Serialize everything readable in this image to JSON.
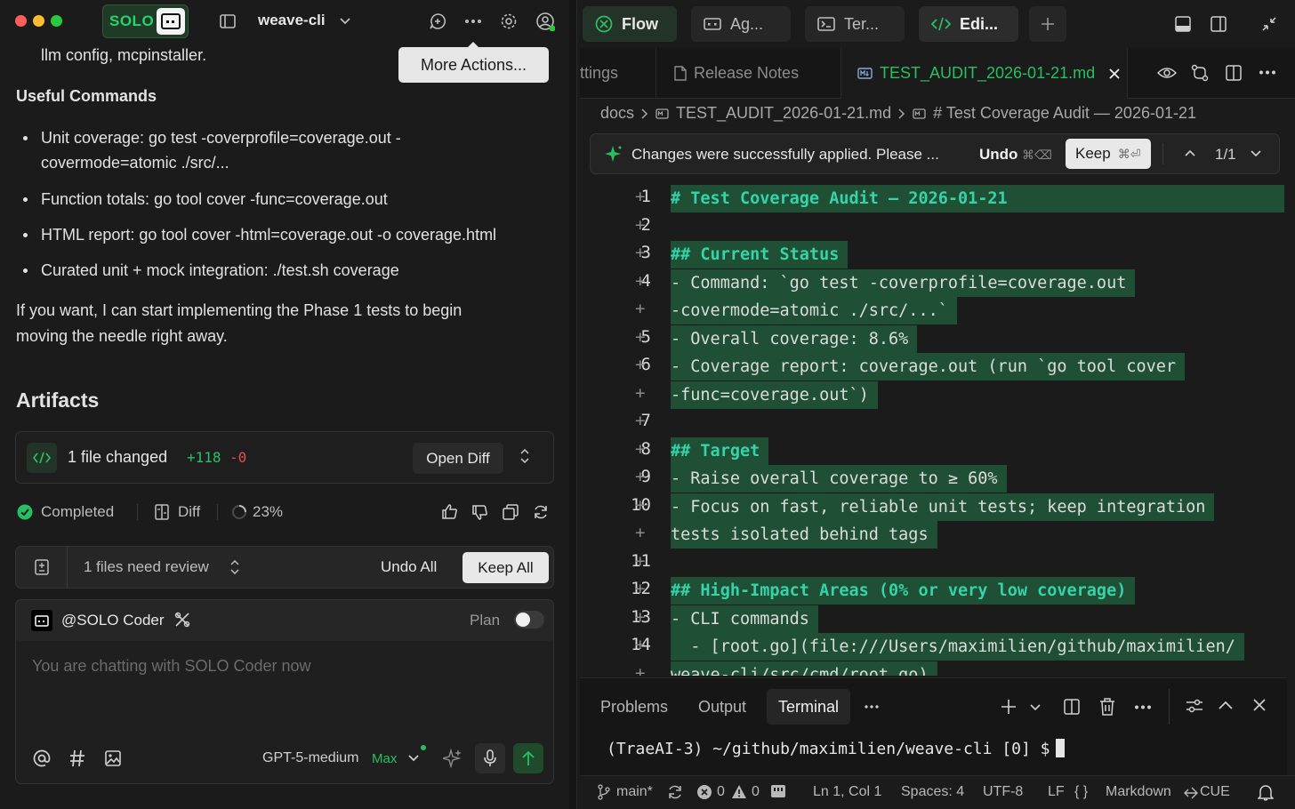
{
  "window": {
    "project": "weave-cli",
    "badge": "SOLO",
    "tooltip": "More Actions..."
  },
  "chat": {
    "line_top": "llm config, mcpinstaller.",
    "useful_heading": "Useful Commands",
    "bullets": [
      "Unit coverage: go test -coverprofile=coverage.out -",
      "covermode=atomic ./src/...",
      "Function totals: go tool cover -func=coverage.out",
      "HTML report: go tool cover -html=coverage.out -o coverage.html",
      "Curated unit + mock integration: ./test.sh coverage"
    ],
    "closing_1": "If you want, I can start implementing the Phase 1 tests to begin",
    "closing_2": "moving the needle right away.",
    "artifacts_heading": "Artifacts",
    "files_changed": "1 file changed",
    "additions": "+118",
    "deletions": "-0",
    "open_diff": "Open Diff",
    "status_completed": "Completed",
    "status_diff": "Diff",
    "status_percent": "23%",
    "review_text": "1 files need review",
    "undo_all": "Undo All",
    "keep_all": "Keep All",
    "agent_name": "@SOLO Coder",
    "plan_label": "Plan",
    "plan_enabled": false,
    "composer_placeholder": "You are chatting with SOLO Coder now",
    "model": "GPT-5-medium",
    "model_tier": "Max"
  },
  "right": {
    "tabs": [
      "Flow",
      "Ag...",
      "Ter...",
      "Edi..."
    ],
    "editor_tabs": [
      "ttings",
      "Release Notes",
      "TEST_AUDIT_2026-01-21.md"
    ],
    "breadcrumb": [
      "docs",
      "TEST_AUDIT_2026-01-21.md",
      "# Test Coverage Audit — 2026-01-21"
    ],
    "notification": "Changes were successfully applied. Please ...",
    "undo": "Undo",
    "undo_shortcut": "⌘⌫",
    "keep": "Keep",
    "keep_shortcut": "⌘⏎",
    "match_count": "1/1",
    "code_lines": [
      {
        "n": "1",
        "text": "# Test Coverage Audit — 2026-01-21"
      },
      {
        "n": "2",
        "text": ""
      },
      {
        "n": "3",
        "text": "## Current Status"
      },
      {
        "n": "4",
        "text": "- Command: `go test -coverprofile=coverage.out"
      },
      {
        "n": "",
        "text": "-covermode=atomic ./src/...`"
      },
      {
        "n": "5",
        "text": "- Overall coverage: 8.6%"
      },
      {
        "n": "6",
        "text": "- Coverage report: coverage.out (run `go tool cover"
      },
      {
        "n": "",
        "text": "-func=coverage.out`)"
      },
      {
        "n": "7",
        "text": ""
      },
      {
        "n": "8",
        "text": "## Target"
      },
      {
        "n": "9",
        "text": "- Raise overall coverage to ≥ 60%"
      },
      {
        "n": "10",
        "text": "- Focus on fast, reliable unit tests; keep integration"
      },
      {
        "n": "",
        "text": "tests isolated behind tags"
      },
      {
        "n": "11",
        "text": ""
      },
      {
        "n": "12",
        "text": "## High-Impact Areas (0% or very low coverage)"
      },
      {
        "n": "13",
        "text": "- CLI commands"
      },
      {
        "n": "14",
        "text": "  - [root.go](file:///Users/maximilien/github/maximilien/"
      },
      {
        "n": "",
        "text": "weave-cli/src/cmd/root.go)"
      }
    ],
    "panel_tabs": [
      "Problems",
      "Output",
      "Terminal"
    ],
    "terminal_prompt": "(TraeAI-3) ~/github/maximilien/weave-cli [0] $",
    "status": {
      "branch": "main*",
      "errors": "0",
      "warnings": "0",
      "cursor": "Ln 1, Col 1",
      "spaces": "Spaces: 4",
      "encoding": "UTF-8",
      "eol": "LF",
      "braces": "{ }",
      "language": "Markdown",
      "cue": "CUE"
    }
  },
  "colors": {
    "accent": "#27c060",
    "diff_bg": "#1f4f35",
    "heading": "#36d3a8"
  }
}
